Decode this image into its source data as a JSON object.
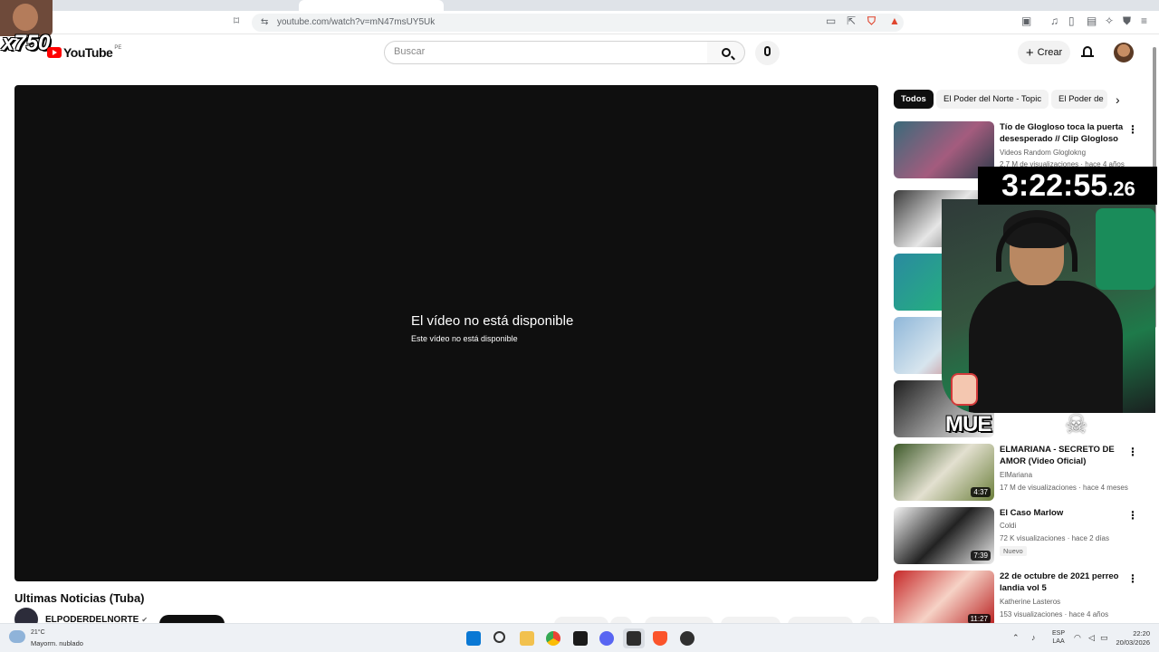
{
  "browser": {
    "url": "youtube.com/watch?v=mN47msUY5Uk"
  },
  "overlay": {
    "multiplier": "x750",
    "timer_main": "3:22:55",
    "timer_fraction": ".26",
    "caption": "MUE"
  },
  "header": {
    "logo_text": "YouTube",
    "region": "PE",
    "search_placeholder": "Buscar",
    "create_label": "Crear"
  },
  "player": {
    "error_title": "El vídeo no está disponible",
    "error_subtitle": "Este vídeo no está disponible"
  },
  "video": {
    "title": "Ultimas Noticias (Tuba)",
    "channel": "ELPODERDELNORTE"
  },
  "chips": [
    "Todos",
    "El Poder del Norte - Topic",
    "El Poder de"
  ],
  "recommendations": [
    {
      "title": "Tío de Glogloso toca la puerta desesperado // Clip Glogloso",
      "channel": "Videos Random Gloglokng",
      "meta": "2,7 M de visualizaciones · hace 4 años"
    },
    {
      "title": "ELMARIANA - SECRETO DE AMOR (Video Oficial)",
      "channel": "ElMariana",
      "meta": "17 M de visualizaciones · hace 4 meses",
      "duration": "4:37"
    },
    {
      "title": "El Caso Marlow",
      "channel": "Coldi",
      "meta": "72 K visualizaciones · hace 2 días",
      "badge": "Nuevo",
      "duration": "7:39"
    },
    {
      "title": "22 de octubre de 2021 perreo landia vol 5",
      "channel": "Katherine Lasteros",
      "meta": "153 visualizaciones · hace 4 años",
      "duration": "11:27"
    }
  ],
  "taskbar": {
    "temperature": "21°C",
    "weather": "Mayorm. nublado",
    "lang_line1": "ESP",
    "lang_line2": "LAA",
    "time": "22:20",
    "date": "20/03/2026"
  },
  "colors": {
    "youtube_red": "#ff0000",
    "player_bg": "#0f0f0f",
    "text_primary": "#0f0f0f",
    "text_secondary": "#606060"
  }
}
